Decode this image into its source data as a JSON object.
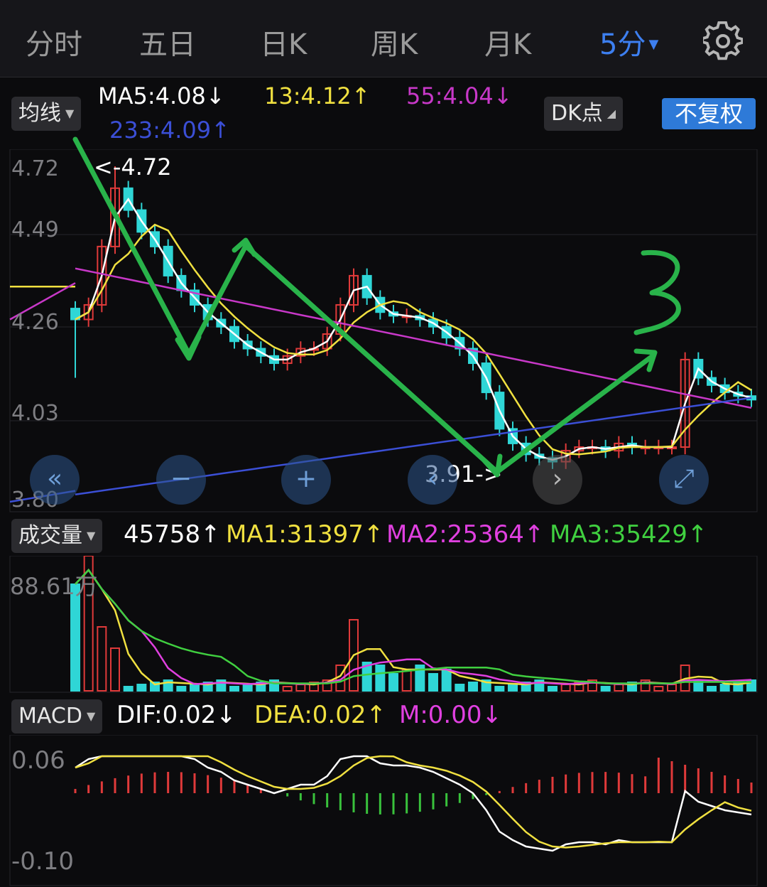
{
  "tabs": [
    {
      "label": "分时",
      "active": false
    },
    {
      "label": "五日",
      "active": false
    },
    {
      "label": "日K",
      "active": false
    },
    {
      "label": "周K",
      "active": false
    },
    {
      "label": "月K",
      "active": false
    },
    {
      "label": "5分",
      "active": true
    }
  ],
  "settings_icon": "gear-icon",
  "ma": {
    "selector": "均线",
    "ma5": "MA5:4.08↓",
    "ma13": "13:4.12↑",
    "ma55": "55:4.04↓",
    "ma233": "233:4.09↑",
    "dk_label": "DK点",
    "fq_label": "不复权"
  },
  "price_axis": [
    "4.72",
    "4.49",
    "4.26",
    "4.03",
    "3.80"
  ],
  "annotations": {
    "high": "<-4.72",
    "low": "3.91->",
    "handwritten": "3"
  },
  "volume": {
    "selector": "成交量",
    "value": "45758↑",
    "ma1": "MA1:31397↑",
    "ma2": "MA2:25364↑",
    "ma3": "MA3:35429↑",
    "axis_max": "88.61万"
  },
  "macd": {
    "selector": "MACD",
    "dif": "DIF:0.02↓",
    "dea": "DEA:0.02↑",
    "m": "M:0.00↓",
    "axis_top": "0.06",
    "axis_bottom": "-0.10"
  },
  "colors": {
    "up": "#e03a3a",
    "down": "#2fd6d6",
    "ma5": "#ffffff",
    "ma13": "#f0e040",
    "ma55": "#c838c8",
    "ma233": "#3b4fd6",
    "accent": "#3d7ff0",
    "arrow": "#29b34a"
  },
  "chart_data": {
    "type": "candlestick",
    "ylim": [
      3.8,
      4.72
    ],
    "high": 4.72,
    "low": 3.91,
    "series_close": [
      4.3,
      4.34,
      4.5,
      4.66,
      4.6,
      4.54,
      4.5,
      4.42,
      4.38,
      4.34,
      4.3,
      4.28,
      4.24,
      4.22,
      4.2,
      4.18,
      4.2,
      4.22,
      4.22,
      4.26,
      4.34,
      4.42,
      4.36,
      4.32,
      4.31,
      4.31,
      4.3,
      4.28,
      4.25,
      4.22,
      4.18,
      4.1,
      4.0,
      3.96,
      3.93,
      3.92,
      3.91,
      3.94,
      3.95,
      3.95,
      3.94,
      3.96,
      3.95,
      3.95,
      3.95,
      3.95,
      4.19,
      4.14,
      4.12,
      4.1,
      4.09,
      4.08
    ]
  }
}
